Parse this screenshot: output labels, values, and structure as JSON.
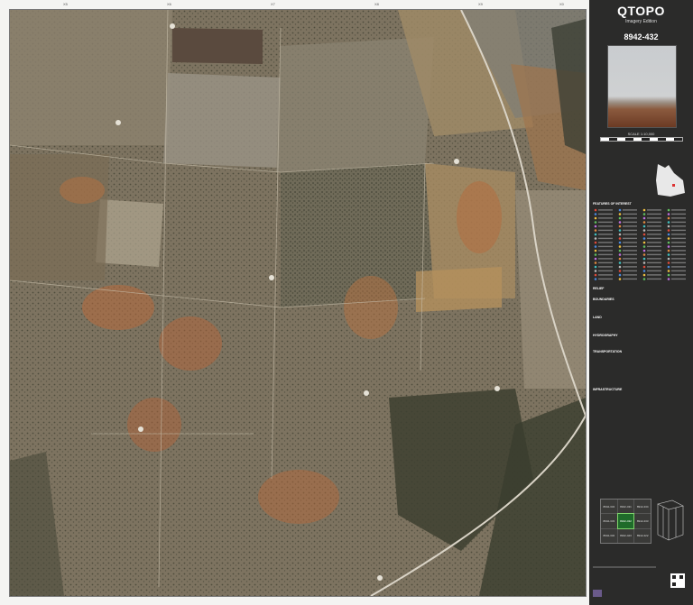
{
  "panel": {
    "title": "QTOPO",
    "subtitle": "Imagery Edition",
    "sheet": "8942-432",
    "scale": "SCALE 1:10,000"
  },
  "ticks_top": [
    "X5",
    "X6",
    "X7",
    "X8",
    "X9",
    "X0"
  ],
  "legend_sections": [
    "FEATURES OF INTEREST",
    "RELIEF",
    "BOUNDARIES",
    "LAND",
    "HYDROGRAPHY",
    "TRANSPORTATION",
    "INFRASTRUCTURE"
  ],
  "grid": [
    "8942-334",
    "8942-431",
    "8942-434",
    "8942-333",
    "8942-432",
    "8942-433",
    "8942-332",
    "8942-423",
    "8942-422"
  ],
  "grid_current": 4,
  "colors": {
    "panel_bg": "#2b2b2a",
    "map_earth": "#8a7a62",
    "road": "#d9d3c6",
    "current_sheet": "#1f6b2a"
  }
}
